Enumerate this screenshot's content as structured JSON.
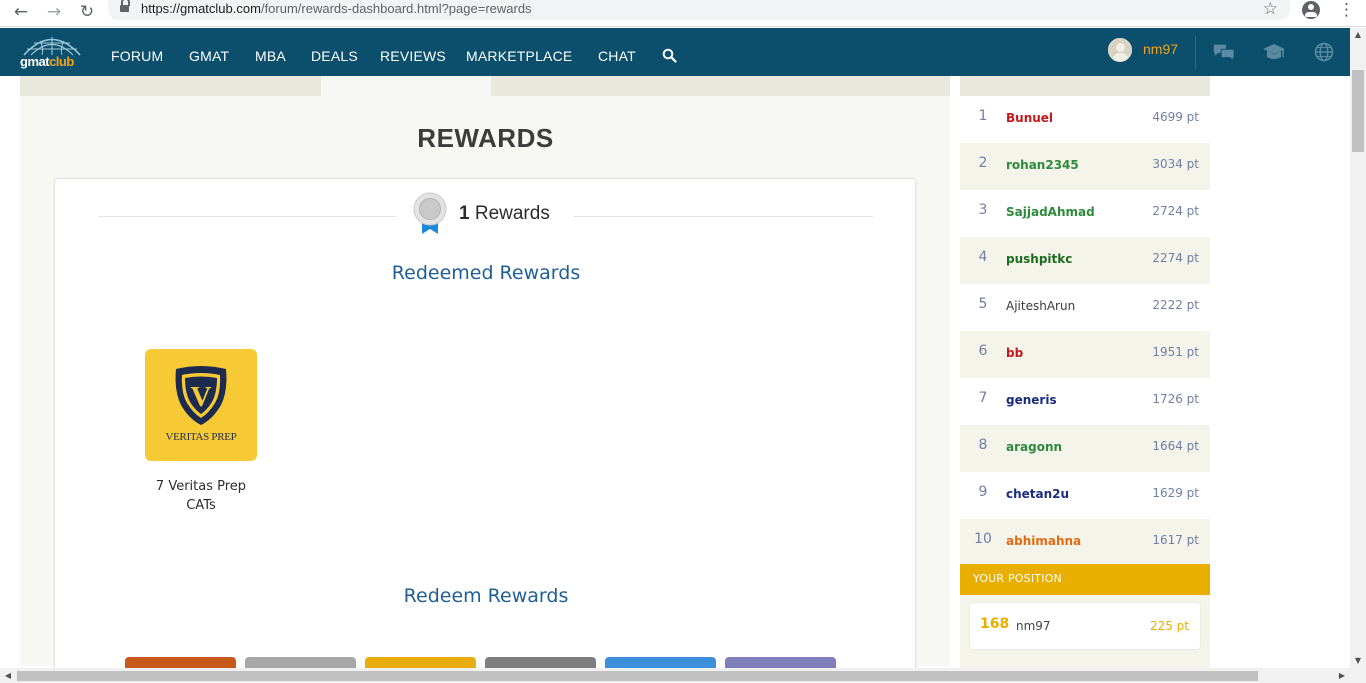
{
  "browser": {
    "back": "←",
    "forward": "→",
    "reload": "↻",
    "url_host": "https://gmatclub.com",
    "url_path": "/forum/rewards-dashboard.html?page=rewards",
    "bookmark": "☆",
    "menu": "⋮"
  },
  "header": {
    "logo_main": "gmat",
    "logo_accent": "club",
    "nav": [
      {
        "label": "FORUM"
      },
      {
        "label": "GMAT"
      },
      {
        "label": "MBA"
      },
      {
        "label": "DEALS"
      },
      {
        "label": "REVIEWS"
      },
      {
        "label": "MARKETPLACE"
      },
      {
        "label": "CHAT"
      }
    ],
    "username": "nm97",
    "icons": [
      "chat-bubbles-icon",
      "graduation-cap-icon",
      "globe-icon"
    ],
    "colors": {
      "bar": "#0b4f6c",
      "accent": "#f2a31b"
    }
  },
  "main": {
    "title": "REWARDS",
    "rewards_count": "1",
    "rewards_label": "Rewards",
    "redeemed_title": "Redeemed Rewards",
    "redeemed_items": [
      {
        "name": "7 Veritas Prep CATs",
        "logo_letter": "V",
        "logo_brand": "VERITAS PREP"
      }
    ],
    "redeem_title": "Redeem Rewards",
    "redeem_tile_colors": [
      "#c8591c",
      "#a7a7a7",
      "#e9ad10",
      "#7e7e7e",
      "#3d8fdb",
      "#7f7fbc"
    ]
  },
  "leaderboard": {
    "rows": [
      {
        "rank": "1",
        "name": "Bunuel",
        "points": "4699 pt",
        "color": "#c0191b",
        "bold": true
      },
      {
        "rank": "2",
        "name": "rohan2345",
        "points": "3034 pt",
        "color": "#2e8b3a",
        "bold": true
      },
      {
        "rank": "3",
        "name": "SajjadAhmad",
        "points": "2724 pt",
        "color": "#2e8b3a",
        "bold": true
      },
      {
        "rank": "4",
        "name": "pushpitkc",
        "points": "2274 pt",
        "color": "#1e6b1e",
        "bold": true
      },
      {
        "rank": "5",
        "name": "AjiteshArun",
        "points": "2222 pt",
        "color": "#3a3a3a",
        "bold": false
      },
      {
        "rank": "6",
        "name": "bb",
        "points": "1951 pt",
        "color": "#c0191b",
        "bold": true
      },
      {
        "rank": "7",
        "name": "generis",
        "points": "1726 pt",
        "color": "#1b2d7e",
        "bold": true
      },
      {
        "rank": "8",
        "name": "aragonn",
        "points": "1664 pt",
        "color": "#2e8b3a",
        "bold": true
      },
      {
        "rank": "9",
        "name": "chetan2u",
        "points": "1629 pt",
        "color": "#1b2d7e",
        "bold": true
      },
      {
        "rank": "10",
        "name": "abhimahna",
        "points": "1617 pt",
        "color": "#e36a12",
        "bold": true
      }
    ],
    "your_position_label": "YOUR POSITION",
    "your_rank": "168",
    "your_name": "nm97",
    "your_points": "225 pt"
  }
}
